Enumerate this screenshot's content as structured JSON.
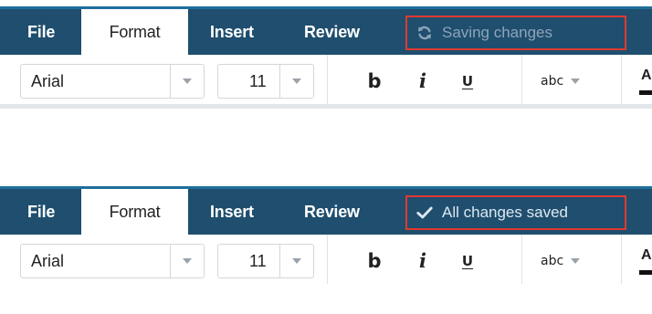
{
  "menu": {
    "file": "File",
    "format": "Format",
    "insert": "Insert",
    "review": "Review"
  },
  "status_states": {
    "saving": {
      "icon": "sync-icon",
      "text": "Saving changes"
    },
    "saved": {
      "icon": "check-icon",
      "text": "All changes saved"
    }
  },
  "formatting": {
    "font_family": "Arial",
    "font_size": "11",
    "bold_label": "b",
    "italic_label": "i",
    "underline_label": "U",
    "case_label": "abc",
    "text_color_icon": "text-color-icon"
  },
  "colors": {
    "menubar": "#1f4e6e",
    "status_box_border": "#e03a2f",
    "saving_text": "#8da5ba",
    "saved_text": "#dde8f1"
  }
}
